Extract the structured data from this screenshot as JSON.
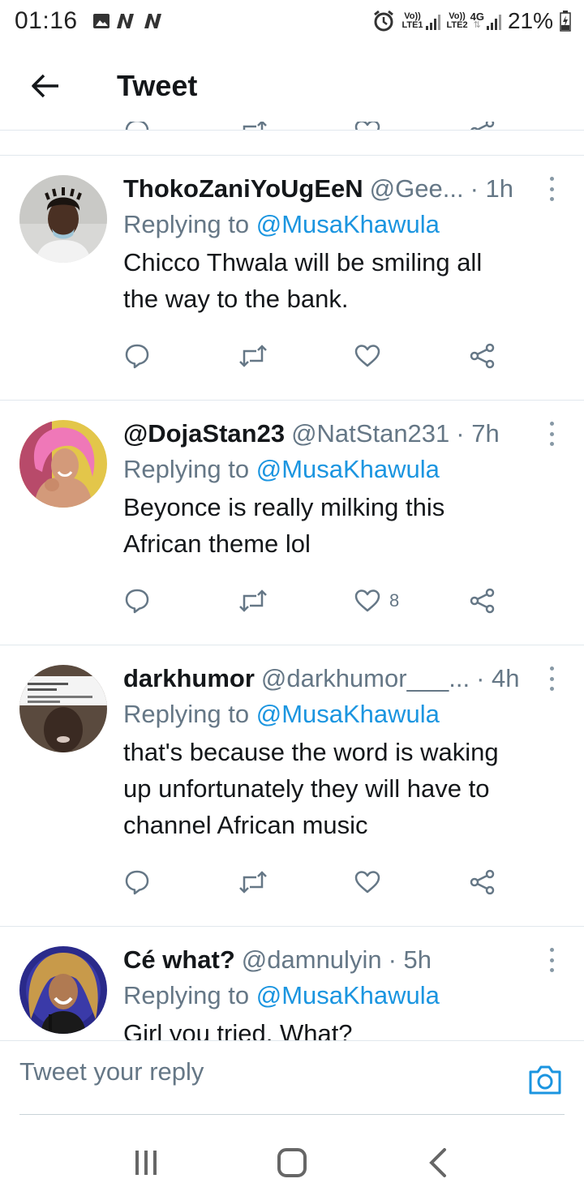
{
  "status_bar": {
    "time": "01:16",
    "sim1_label_top": "Vo))",
    "sim1_label_bottom": "LTE1",
    "sim2_label_top": "Vo))",
    "sim2_label_bottom": "LTE2",
    "network_type": "4G",
    "battery": "21%",
    "icons": [
      "image-icon",
      "n-icon",
      "n-icon",
      "alarm-icon",
      "signal-icon",
      "battery-charging-icon"
    ]
  },
  "header": {
    "title": "Tweet",
    "back_icon": "arrow-left-icon"
  },
  "tweets": [
    {
      "name": "ThokoZaniYoUgEeN",
      "handle": "@Gee...",
      "time": "· 1h",
      "replying_prefix": "Replying to ",
      "replying_to": "@MusaKhawula",
      "text_lines": [
        "Chicco Thwala will be smiling  all",
        "the way to the bank."
      ],
      "like_count": ""
    },
    {
      "name": "@DojaStan23",
      "handle": "@NatStan231",
      "time": "· 7h",
      "replying_prefix": "Replying to ",
      "replying_to": "@MusaKhawula",
      "text_lines": [
        "Beyonce is really milking this",
        "African theme lol"
      ],
      "like_count": "8"
    },
    {
      "name": "darkhumor",
      "handle": "@darkhumor___...",
      "time": "· 4h",
      "replying_prefix": "Replying to ",
      "replying_to": "@MusaKhawula",
      "text_lines": [
        "that's because the word is waking",
        "up unfortunately they will have to",
        "channel African music"
      ],
      "like_count": ""
    },
    {
      "name": "Cé what?",
      "handle": "@damnulyin",
      "time": "· 5h",
      "replying_prefix": "Replying to ",
      "replying_to": "@MusaKhawula",
      "text_lines": [
        "Girl you tried. What?"
      ],
      "like_count": ""
    }
  ],
  "reply_box": {
    "placeholder": "Tweet your reply",
    "camera_icon": "camera-icon"
  },
  "nav_bar": {
    "icons": [
      "recent-apps-icon",
      "home-icon",
      "back-icon"
    ]
  },
  "colors": {
    "accent": "#1b95e0",
    "secondary_text": "#657786",
    "primary_text": "#14171a",
    "divider": "#e1e8ed"
  }
}
